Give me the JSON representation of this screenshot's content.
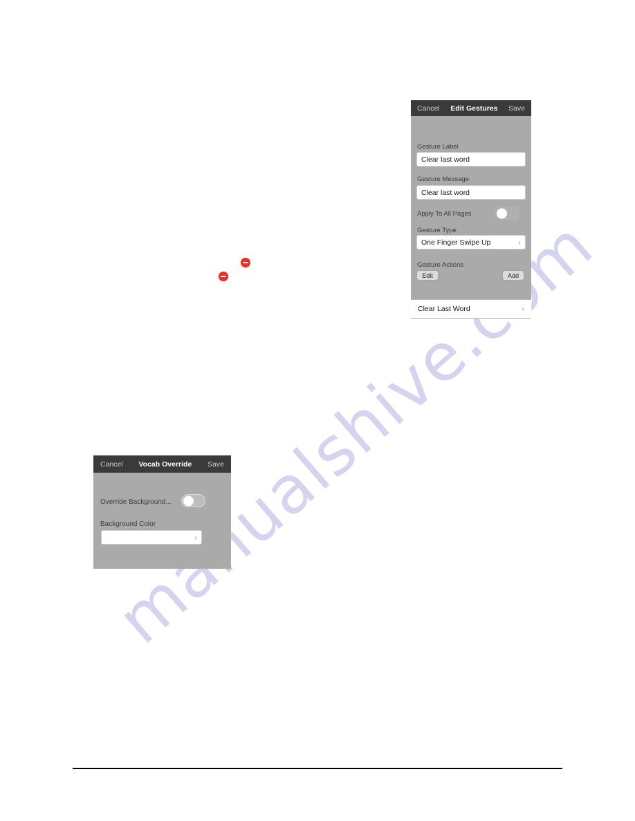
{
  "watermark": {
    "text": "manualshive.com",
    "color": "#9a9ada"
  },
  "colors": {
    "header_bar": "#3a3a3a",
    "panel_background": "#aaaaaa",
    "field_background": "#ffffff",
    "delete_badge": "#ed3024",
    "button_face": "#dcdcdc"
  },
  "gestures_panel": {
    "header": {
      "cancel_label": "Cancel",
      "title": "Edit Gestures",
      "save_label": "Save"
    },
    "gesture_label": {
      "label": "Gesture Label",
      "value": "Clear last word"
    },
    "gesture_message": {
      "label": "Gesture Message",
      "value": "Clear last word"
    },
    "apply_to_all_pages": {
      "label": "Apply To All Pages",
      "state": "off"
    },
    "gesture_type": {
      "label": "Gesture Type",
      "value": "One Finger Swipe Up",
      "chevron": "›"
    },
    "gesture_actions": {
      "label": "Gesture Actions",
      "edit_label": "Edit",
      "add_label": "Add"
    },
    "action_row": {
      "label": "Clear Last Word",
      "chevron": "›"
    }
  },
  "vocab_panel": {
    "header": {
      "cancel_label": "Cancel",
      "title": "Vocab Override",
      "save_label": "Save"
    },
    "override_background": {
      "label": "Override Background...",
      "state": "off"
    },
    "background_color": {
      "label": "Background Color",
      "value": "",
      "chevron": "›"
    }
  },
  "markers": [
    {
      "name": "delete-badge-upper",
      "glyph": "−"
    },
    {
      "name": "delete-badge-lower",
      "glyph": "−"
    }
  ]
}
